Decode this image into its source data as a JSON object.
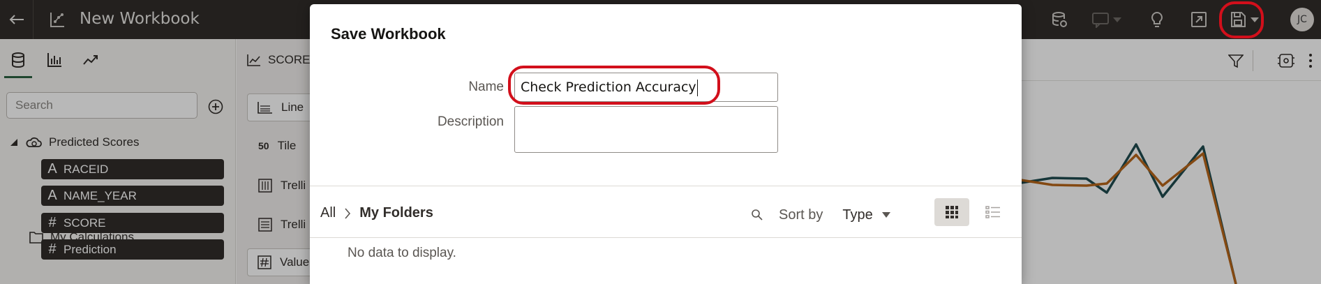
{
  "header": {
    "title": "New Workbook",
    "user_initials": "JC"
  },
  "left_panel": {
    "search_placeholder": "Search",
    "dataset_name": "Predicted Scores",
    "columns": [
      {
        "glyph": "A",
        "name": "RACEID"
      },
      {
        "glyph": "A",
        "name": "NAME_YEAR"
      },
      {
        "glyph": "#",
        "name": "SCORE"
      },
      {
        "glyph": "#",
        "name": "Prediction"
      }
    ],
    "calculations_label": "My Calculations"
  },
  "viz_panel": {
    "header": "SCORE",
    "items": [
      "Line",
      "Tile",
      "Trelli",
      "Trelli",
      "Value"
    ],
    "tile_icon_text": "50"
  },
  "dialog": {
    "title": "Save Workbook",
    "name_label": "Name",
    "name_value": "Check Prediction Accuracy",
    "description_label": "Description",
    "description_value": "",
    "breadcrumb_root": "All",
    "breadcrumb_current": "My Folders",
    "sort_by_label": "Sort by",
    "sort_value": "Type",
    "empty_message": "No data to display."
  },
  "chart_data": {
    "type": "line",
    "series": [
      {
        "color": "#1f4b4f",
        "values": [
          262,
          255,
          256,
          276,
          207,
          282,
          210,
          407
        ]
      },
      {
        "color": "#b8661a",
        "values": [
          258,
          265,
          266,
          263,
          222,
          266,
          220,
          407
        ]
      }
    ]
  },
  "colors": {
    "topbar": "#312d2a",
    "accent_green": "#2b6242",
    "highlight_ring": "#d20f1b"
  }
}
